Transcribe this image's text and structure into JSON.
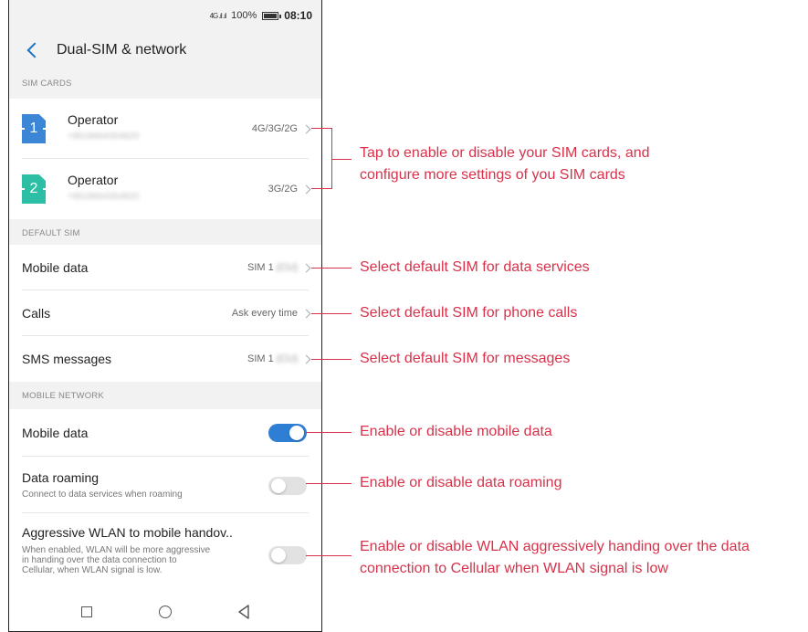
{
  "status_bar": {
    "network": "4G .ıl .ıl",
    "battery": "100%",
    "time": "08:10"
  },
  "header": {
    "title": "Dual-SIM & network"
  },
  "sim_cards": {
    "section_label": "SIM CARDS",
    "items": [
      {
        "slot": "1",
        "name": "Operator",
        "number": "+8618664354820",
        "value": "4G/3G/2G"
      },
      {
        "slot": "2",
        "name": "Operator",
        "number": "+8618664354820",
        "value": "3G/2G"
      }
    ]
  },
  "default_sim": {
    "section_label": "DEFAULT SIM",
    "items": [
      {
        "label": "Mobile data",
        "value": "SIM 1",
        "value_extra": "(CU)"
      },
      {
        "label": "Calls",
        "value": "Ask every time",
        "value_extra": ""
      },
      {
        "label": "SMS messages",
        "value": "SIM 1",
        "value_extra": "(CU)"
      }
    ]
  },
  "mobile_network": {
    "section_label": "MOBILE NETWORK",
    "mobile_data": {
      "label": "Mobile data",
      "enabled": true
    },
    "data_roaming": {
      "label": "Data roaming",
      "sub": "Connect to data services when roaming",
      "enabled": false
    },
    "aggressive_wlan": {
      "label": "Aggressive WLAN to mobile handov..",
      "sub_lines": [
        "When enabled, WLAN will be more aggressive",
        "in handing over the data connection to",
        "Cellular, when WLAN signal is low."
      ],
      "enabled": false
    }
  },
  "navbar": {
    "icons": [
      "recent-apps-icon",
      "home-icon",
      "back-nav-icon"
    ]
  },
  "callouts": {
    "sim_cards": [
      "Tap to enable or disable your SIM cards, and",
      "configure more settings of you SIM cards"
    ],
    "mobile_data_default": "Select default SIM for data services",
    "calls_default": "Select default SIM for phone calls",
    "sms_default": "Select default SIM for messages",
    "mobile_data_toggle": "Enable or disable mobile data",
    "data_roaming_toggle": "Enable or disable data roaming",
    "aggressive_wlan_toggle": [
      "Enable or disable WLAN aggressively handing over the data",
      "connection to Cellular when WLAN signal is low"
    ]
  },
  "colors": {
    "accent": "#2e7fd4",
    "callout": "#d8324b",
    "sim1": "#3b87d6",
    "sim2": "#2dbfa6"
  }
}
